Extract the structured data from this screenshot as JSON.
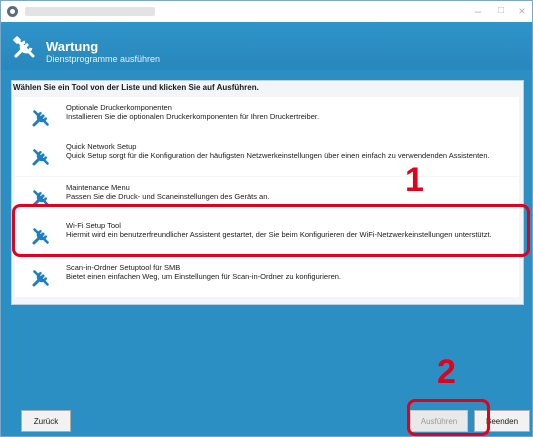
{
  "window": {
    "title_bar": {
      "minimize": "–",
      "maximize": "□",
      "close": "×"
    }
  },
  "header": {
    "title": "Wartung",
    "subtitle": "Dienstprogramme ausführen",
    "icon": "tools-icon"
  },
  "main": {
    "instruction": "Wählen Sie ein Tool von der Liste und klicken Sie auf Ausführen.",
    "tools": [
      {
        "name": "Optionale Druckerkomponenten",
        "description": "Installieren Sie die optionalen Druckerkomponenten für Ihren Druckertreiber.",
        "icon": "tools-icon"
      },
      {
        "name": "Quick Network Setup",
        "description": "Quick Setup sorgt für die Konfiguration der häufigsten Netzwerkeinstellungen über einen einfach zu verwendenden Assistenten.",
        "icon": "tools-icon"
      },
      {
        "name": "Maintenance Menu",
        "description": "Passen Sie die Druck- und Scaneinstellungen des Geräts an.",
        "icon": "tools-icon"
      },
      {
        "name": "Wi-Fi Setup Tool",
        "description": "Hiermit wird ein benutzerfreundlicher Assistent gestartet, der Sie beim Konfigurieren der WiFi-Netzwerkeinstellungen unterstützt.",
        "icon": "tools-icon"
      },
      {
        "name": "Scan-in-Ordner Setuptool für SMB",
        "description": "Bietet einen einfachen Weg, um Einstellungen für Scan-in-Ordner zu konfigurieren.",
        "icon": "tools-icon"
      }
    ]
  },
  "callouts": {
    "one": "1",
    "two": "2"
  },
  "footer": {
    "back_label": "Zurück",
    "run_label": "Ausführen",
    "exit_label": "Beenden"
  },
  "colors": {
    "accent": "#2b8fc4",
    "highlight": "#e2001a"
  }
}
